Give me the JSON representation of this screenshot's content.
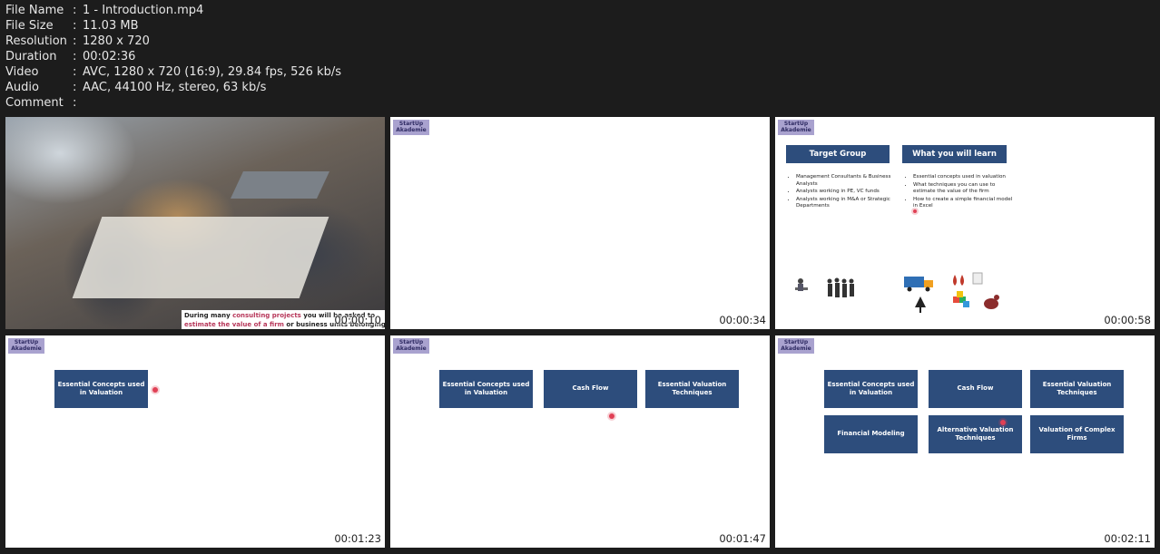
{
  "meta": [
    {
      "key": "File Name",
      "value": "1 - Introduction.mp4"
    },
    {
      "key": "File Size",
      "value": "11.03 MB"
    },
    {
      "key": "Resolution",
      "value": "1280 x 720"
    },
    {
      "key": "Duration",
      "value": "00:02:36"
    },
    {
      "key": "Video",
      "value": "AVC, 1280 x 720 (16:9), 29.84 fps, 526 kb/s"
    },
    {
      "key": "Audio",
      "value": "AAC, 44100 Hz, stereo, 63 kb/s"
    },
    {
      "key": "Comment",
      "value": ""
    }
  ],
  "separator": ":",
  "logo_text": "StartUp Akademie",
  "thumbs": {
    "t1": {
      "timestamp": "00:00:10",
      "caption_a": "During many ",
      "caption_hl1": "consulting projects",
      "caption_b": " you will be asked to ",
      "caption_hl2": "estimate the value of a firm",
      "caption_c": " or business units belonging to the firm"
    },
    "t2": {
      "timestamp": "00:00:34"
    },
    "t3": {
      "timestamp": "00:00:58",
      "target_title": "Target  Group",
      "learn_title": "What you will learn",
      "target_items": [
        "Management Consultants & Business Analysts",
        "Analysts working in PE, VC funds",
        "Analysts working  in M&A or Strategic Departments"
      ],
      "learn_items": [
        "Essential concepts used in valuation",
        "What techniques you can use to estimate the value of the firm",
        "How to create a simple financial model in Excel"
      ]
    },
    "t4": {
      "timestamp": "00:01:23",
      "box1": "Essential Concepts used in Valuation"
    },
    "t5": {
      "timestamp": "00:01:47",
      "box1": "Essential Concepts used in Valuation",
      "box2": "Cash Flow",
      "box3": "Essential Valuation Techniques"
    },
    "t6": {
      "timestamp": "00:02:11",
      "box1": "Essential Concepts used in Valuation",
      "box2": "Cash Flow",
      "box3": "Essential Valuation Techniques",
      "box4": "Financial Modeling",
      "box5": "Alternative Valuation Techniques",
      "box6": "Valuation of Complex Firms"
    }
  },
  "colors": {
    "box": "#2d4d7c",
    "accent": "#b7375a",
    "pointer": "#e04055",
    "logo_bg": "#a9a2cf"
  }
}
